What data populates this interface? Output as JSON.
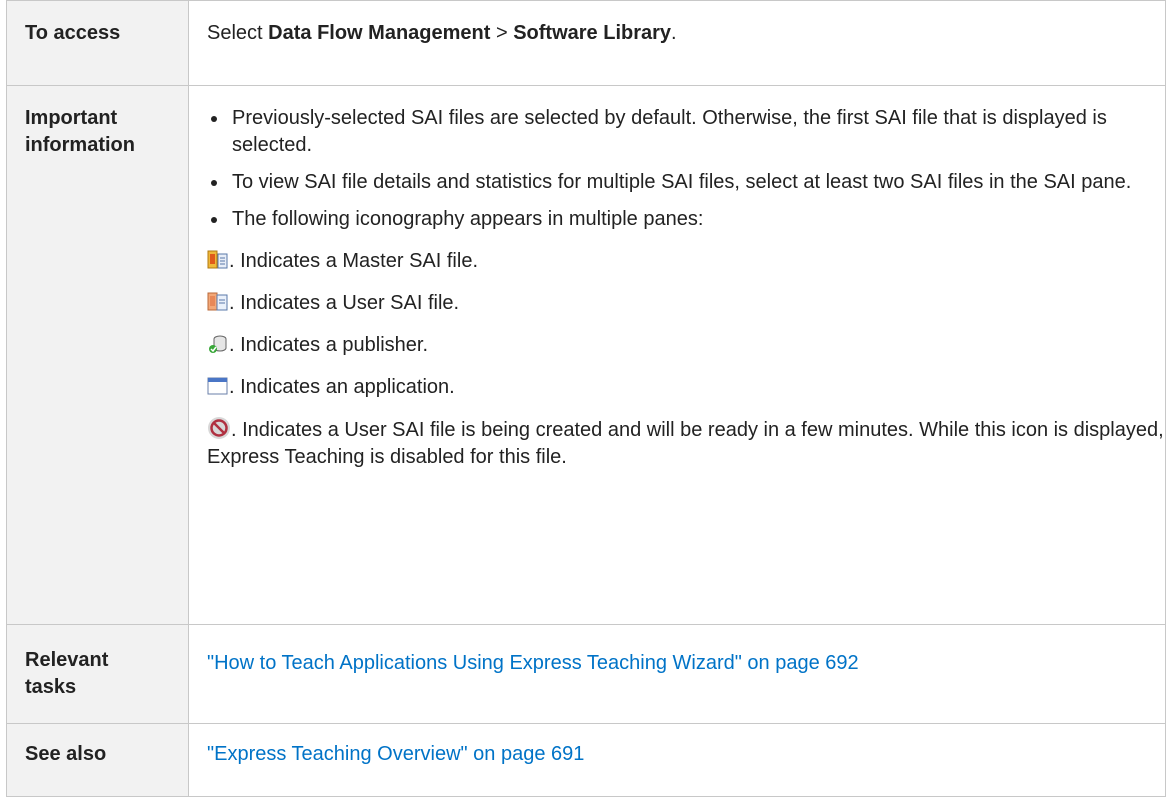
{
  "rows": {
    "access": {
      "label": "To access",
      "prefix": "Select ",
      "menu1": "Data Flow Management",
      "sep": " > ",
      "menu2": "Software Library",
      "suffix": "."
    },
    "important": {
      "label_line1": "Important",
      "label_line2": "information",
      "bullets": [
        "Previously-selected SAI files are selected by default. Otherwise, the first SAI file that is displayed is selected.",
        "To view SAI file details and statistics for multiple SAI files, select at least two SAI files in the SAI pane.",
        "The following iconography appears in multiple panes:"
      ],
      "icons": [
        {
          "icon": "master-sai-file-icon",
          "text": ". Indicates a Master SAI file."
        },
        {
          "icon": "user-sai-file-icon",
          "text": ". Indicates a User SAI file."
        },
        {
          "icon": "publisher-icon",
          "text": ". Indicates a publisher."
        },
        {
          "icon": "application-icon",
          "text": ". Indicates an application."
        },
        {
          "icon": "creating-sai-file-icon",
          "text": ". Indicates a User SAI file is being created and will be ready in a few minutes. While this icon is displayed, Express Teaching is disabled for this file."
        }
      ]
    },
    "tasks": {
      "label_line1": "Relevant",
      "label_line2": "tasks",
      "link": "\"How to Teach Applications Using Express Teaching Wizard\" on page 692"
    },
    "see_also": {
      "label": "See also",
      "link": "\"Express Teaching Overview\" on page 691"
    }
  },
  "colors": {
    "label_bg": "#f2f2f2",
    "border": "#c8c8c8",
    "link": "#0073c7"
  }
}
